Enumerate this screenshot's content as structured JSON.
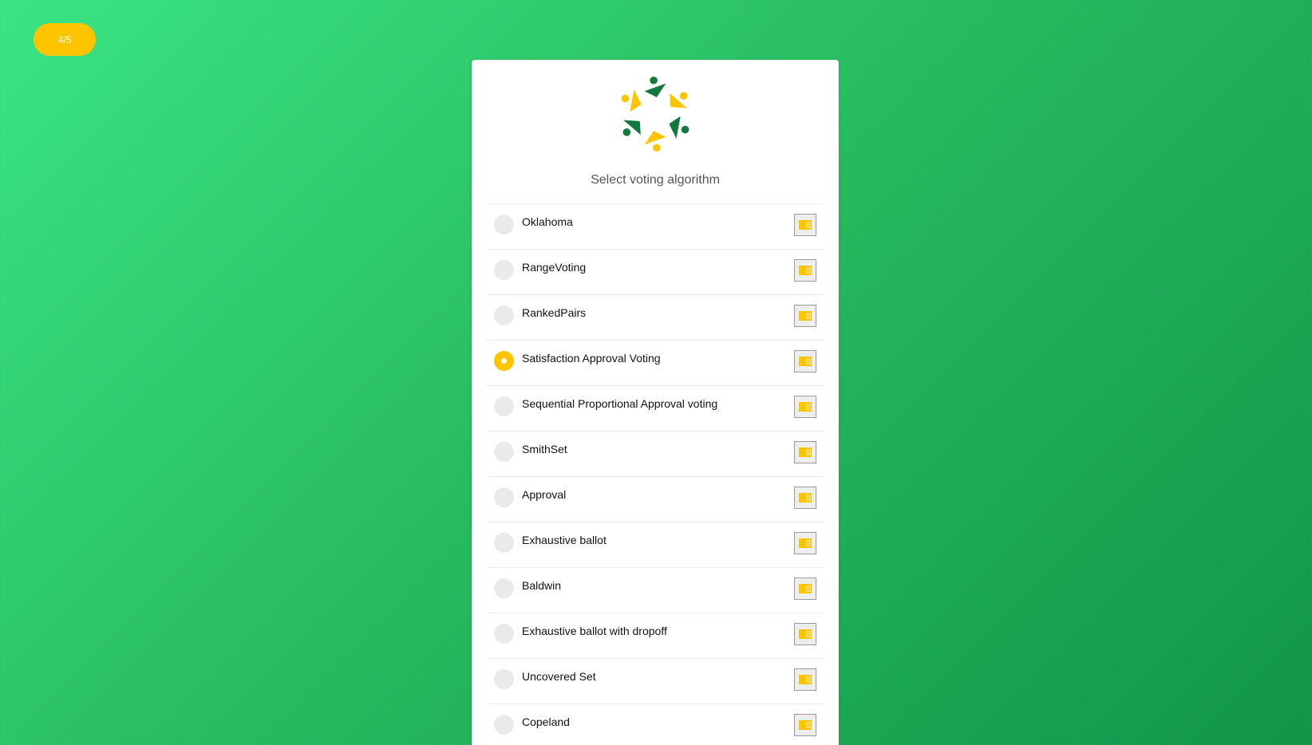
{
  "step": {
    "label": "4/5"
  },
  "card": {
    "title": "Select voting algorithm"
  },
  "options": [
    {
      "label": "Oklahoma",
      "selected": false
    },
    {
      "label": "RangeVoting",
      "selected": false
    },
    {
      "label": "RankedPairs",
      "selected": false
    },
    {
      "label": "Satisfaction Approval Voting",
      "selected": true
    },
    {
      "label": "Sequential Proportional Approval voting",
      "selected": false
    },
    {
      "label": "SmithSet",
      "selected": false
    },
    {
      "label": "Approval",
      "selected": false
    },
    {
      "label": "Exhaustive ballot",
      "selected": false
    },
    {
      "label": "Baldwin",
      "selected": false
    },
    {
      "label": "Exhaustive ballot with dropoff",
      "selected": false
    },
    {
      "label": "Uncovered Set",
      "selected": false
    },
    {
      "label": "Copeland",
      "selected": false
    }
  ],
  "icons": {
    "info_button": "info-card-icon",
    "logo": "people-circle-logo"
  },
  "colors": {
    "accent": "#ffc400",
    "brand_green": "#0f7a3c",
    "background_start": "#3be484",
    "background_end": "#12954a"
  }
}
